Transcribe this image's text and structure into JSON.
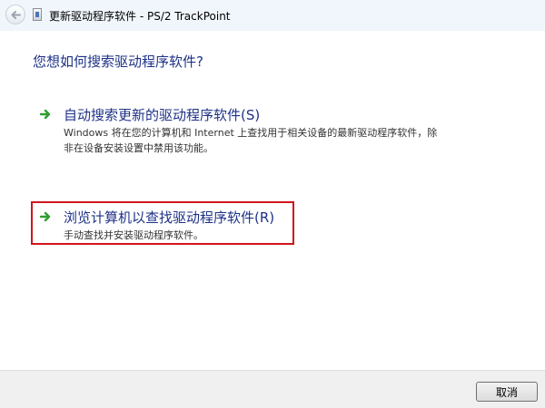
{
  "window": {
    "title": "更新驱动程序软件 - PS/2 TrackPoint",
    "back_icon": "back-arrow-icon",
    "app_icon": "device-icon"
  },
  "main": {
    "heading": "您想如何搜索驱动程序软件?",
    "options": [
      {
        "title": "自动搜索更新的驱动程序软件(S)",
        "description": "Windows 将在您的计算机和 Internet 上查找用于相关设备的最新驱动程序软件，除非在设备安装设置中禁用该功能。",
        "icon": "green-arrow-icon"
      },
      {
        "title": "浏览计算机以查找驱动程序软件(R)",
        "description": "手动查找并安装驱动程序软件。",
        "icon": "green-arrow-icon",
        "highlighted": true
      }
    ]
  },
  "footer": {
    "cancel_label": "取消"
  },
  "colors": {
    "heading": "#1e3287",
    "highlight_border": "#d0151b",
    "arrow": "#2e9e2e"
  }
}
